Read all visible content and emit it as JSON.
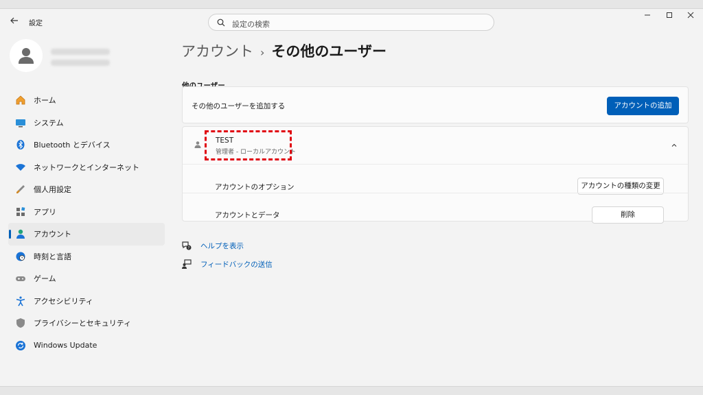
{
  "titlebar": {
    "back_icon": "arrow-left-icon",
    "title": "設定",
    "search_placeholder": "設定の検索",
    "controls": [
      "minimize-icon",
      "maximize-icon",
      "close-icon"
    ]
  },
  "nav": {
    "items": [
      {
        "label": "ホーム",
        "icon": "home-icon",
        "active": false
      },
      {
        "label": "システム",
        "icon": "display-icon",
        "active": false
      },
      {
        "label": "Bluetooth とデバイス",
        "icon": "bluetooth-icon",
        "active": false
      },
      {
        "label": "ネットワークとインターネット",
        "icon": "wifi-icon",
        "active": false
      },
      {
        "label": "個人用設定",
        "icon": "brush-icon",
        "active": false
      },
      {
        "label": "アプリ",
        "icon": "apps-icon",
        "active": false
      },
      {
        "label": "アカウント",
        "icon": "person-icon",
        "active": true
      },
      {
        "label": "時刻と言語",
        "icon": "globe-clock-icon",
        "active": false
      },
      {
        "label": "ゲーム",
        "icon": "gamepad-icon",
        "active": false
      },
      {
        "label": "アクセシビリティ",
        "icon": "accessibility-icon",
        "active": false
      },
      {
        "label": "プライバシーとセキュリティ",
        "icon": "shield-icon",
        "active": false
      },
      {
        "label": "Windows Update",
        "icon": "update-icon",
        "active": false
      }
    ]
  },
  "main": {
    "breadcrumb_parent": "アカウント",
    "breadcrumb_separator": "›",
    "breadcrumb_current": "その他のユーザー",
    "section_title": "他のユーザー",
    "add_user_label": "その他のユーザーを追加する",
    "add_account_button": "アカウントの追加",
    "user": {
      "name": "TEST",
      "role": "管理者 - ローカルアカウント",
      "chevron": "^"
    },
    "account_options_label": "アカウントのオプション",
    "change_type_button": "アカウントの種類の変更",
    "account_data_label": "アカウントとデータ",
    "delete_button": "削除",
    "help_link": "ヘルプを表示",
    "feedback_link": "フィードバックの送信"
  },
  "colors": {
    "accent": "#005fb8",
    "highlight": "#e0000d"
  }
}
